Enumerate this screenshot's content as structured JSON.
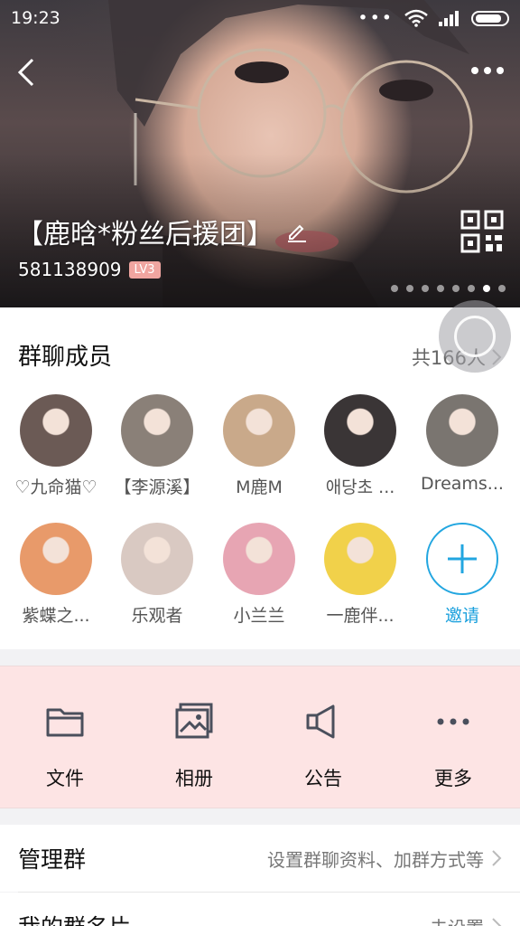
{
  "status_bar": {
    "time": "19:23"
  },
  "header": {
    "group_name": "【鹿晗*粉丝后援团】",
    "group_id": "581138909",
    "level": "LV3",
    "pager_count": 8,
    "pager_active": 6
  },
  "members": {
    "title": "群聊成员",
    "count_label": "共166人",
    "list": [
      {
        "name": "♡九命猫♡",
        "color": "#6b5a55"
      },
      {
        "name": "【李源溪】",
        "color": "#8a8078"
      },
      {
        "name": "M鹿M",
        "color": "#c9a98a"
      },
      {
        "name": "애당초 ...",
        "color": "#3a3536"
      },
      {
        "name": "Dreams...",
        "color": "#7a7570"
      },
      {
        "name": "紫蝶之...",
        "color": "#e89a6a"
      },
      {
        "name": "乐观者",
        "color": "#d9c9c2"
      },
      {
        "name": "小兰兰",
        "color": "#e7a5b3"
      },
      {
        "name": "一鹿伴...",
        "color": "#f1d14a"
      }
    ],
    "invite_label": "邀请"
  },
  "actions": [
    {
      "label": "文件",
      "icon": "folder-icon"
    },
    {
      "label": "相册",
      "icon": "album-icon"
    },
    {
      "label": "公告",
      "icon": "megaphone-icon"
    },
    {
      "label": "更多",
      "icon": "more-dots-icon"
    }
  ],
  "rows": {
    "manage": {
      "label": "管理群",
      "value": "设置群聊资料、加群方式等"
    },
    "card": {
      "label": "我的群名片",
      "value": "未设置"
    }
  },
  "colors": {
    "accent": "#1aa0dd",
    "actions_bg": "#fde4e4",
    "level_badge": "#f0a5a0"
  }
}
